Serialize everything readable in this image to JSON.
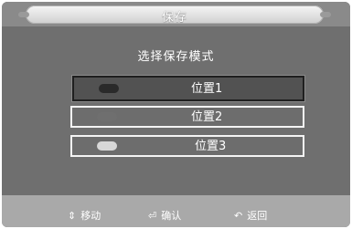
{
  "dialog": {
    "title": "保存",
    "prompt": "选择保存模式"
  },
  "options": [
    {
      "label": "位置1",
      "swatch_color": "#2a2a2a",
      "selected": true
    },
    {
      "label": "位置2",
      "swatch_color": "#6f6f6f",
      "selected": false
    },
    {
      "label": "位置3",
      "swatch_color": "#d8d8d8",
      "selected": false
    }
  ],
  "hints": [
    {
      "icon": "up-down-arrows-icon",
      "glyph": "⇕",
      "label": "移动"
    },
    {
      "icon": "enter-icon",
      "glyph": "⏎",
      "label": "确认"
    },
    {
      "icon": "return-icon",
      "glyph": "↶",
      "label": "返回"
    }
  ],
  "colors": {
    "panel": "#6f6f6f",
    "title_bar": "#8a8a8a",
    "status_bar": "#a9a9a9",
    "option_border": "#f4f4f4",
    "selected_border": "#1f1f1f"
  }
}
